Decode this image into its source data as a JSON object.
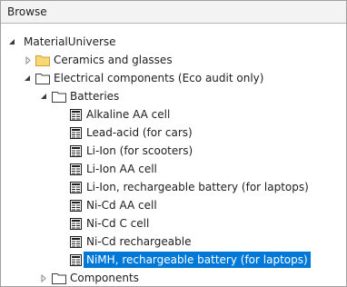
{
  "panel": {
    "title": "Browse"
  },
  "tree": {
    "root_label": "MaterialUniverse",
    "ceramics_label": "Ceramics and glasses",
    "electrical_label": "Electrical components (Eco audit only)",
    "batteries_label": "Batteries",
    "items": [
      "Alkaline AA cell",
      "Lead-acid (for cars)",
      "Li-Ion (for scooters)",
      "Li-Ion AA cell",
      "Li-Ion, rechargeable battery (for laptops)",
      "Ni-Cd AA cell",
      "Ni-Cd C cell",
      "Ni-Cd rechargeable",
      "NiMH, rechargeable battery (for laptops)"
    ],
    "selected_item": "NiMH, rechargeable battery (for laptops)",
    "components_label": "Components"
  },
  "colors": {
    "selection": "#0078d7",
    "folder_yellow": "#f8d775",
    "header_bg": "#f3f3f3"
  },
  "icons": {
    "expanded": "expanded-arrow-icon",
    "collapsed": "collapsed-arrow-icon",
    "folder_closed": "folder-icon",
    "folder_open": "folder-open-icon",
    "record": "record-icon"
  }
}
